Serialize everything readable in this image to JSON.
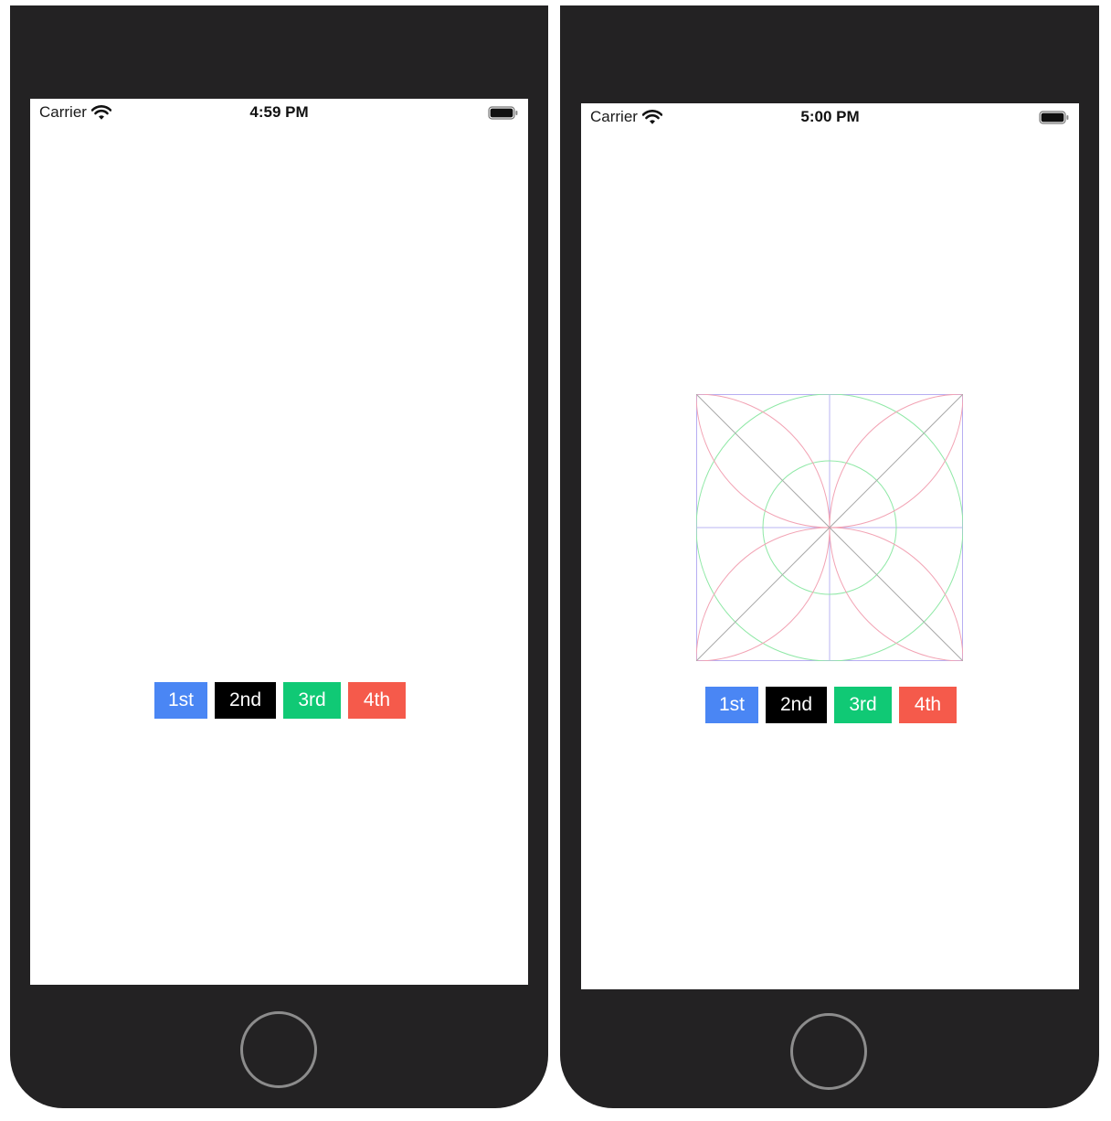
{
  "colors": {
    "button_1st": "#4a86f4",
    "button_2nd": "#000000",
    "button_3rd": "#10c975",
    "button_4th": "#f55a4b",
    "device_body": "#232223",
    "home_ring": "#8c8c8c",
    "square_outline": "#b7aef2",
    "petal_arcs": "#f2a3b4",
    "circles": "#8fe8a6",
    "diagonals": "#a9a9a9",
    "axes": "#b9b4f3"
  },
  "left_phone": {
    "status_bar": {
      "carrier": "Carrier",
      "time": "4:59 PM",
      "wifi_icon": "wifi-icon",
      "battery_icon": "battery-icon"
    },
    "buttons": [
      "1st",
      "2nd",
      "3rd",
      "4th"
    ]
  },
  "right_phone": {
    "status_bar": {
      "carrier": "Carrier",
      "time": "5:00 PM",
      "wifi_icon": "wifi-icon",
      "battery_icon": "battery-icon"
    },
    "buttons": [
      "1st",
      "2nd",
      "3rd",
      "4th"
    ],
    "has_drawing": true
  }
}
